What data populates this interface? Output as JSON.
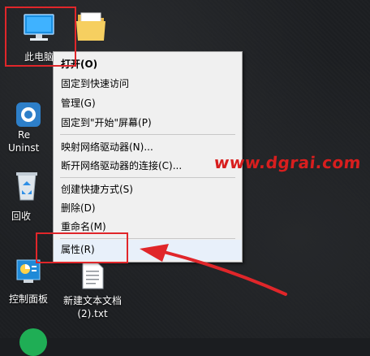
{
  "desktop": {
    "icons": [
      {
        "label": "此电脑"
      },
      {
        "label": "Re"
      },
      {
        "label": "Uninst"
      },
      {
        "label": "回收"
      },
      {
        "label": "控制面板"
      },
      {
        "label": "新建文本文档"
      },
      {
        "label": "(2).txt"
      }
    ]
  },
  "context_menu": {
    "items": [
      {
        "label": "打开(O)"
      },
      {
        "label": "固定到快速访问"
      },
      {
        "label": "管理(G)"
      },
      {
        "label": "固定到\"开始\"屏幕(P)"
      },
      {
        "label": "映射网络驱动器(N)..."
      },
      {
        "label": "断开网络驱动器的连接(C)..."
      },
      {
        "label": "创建快捷方式(S)"
      },
      {
        "label": "删除(D)"
      },
      {
        "label": "重命名(M)"
      },
      {
        "label": "属性(R)"
      }
    ]
  },
  "watermark": "www.dgrai.com",
  "colors": {
    "highlight": "#e0262a",
    "menu_bg": "#f0f0f0"
  }
}
